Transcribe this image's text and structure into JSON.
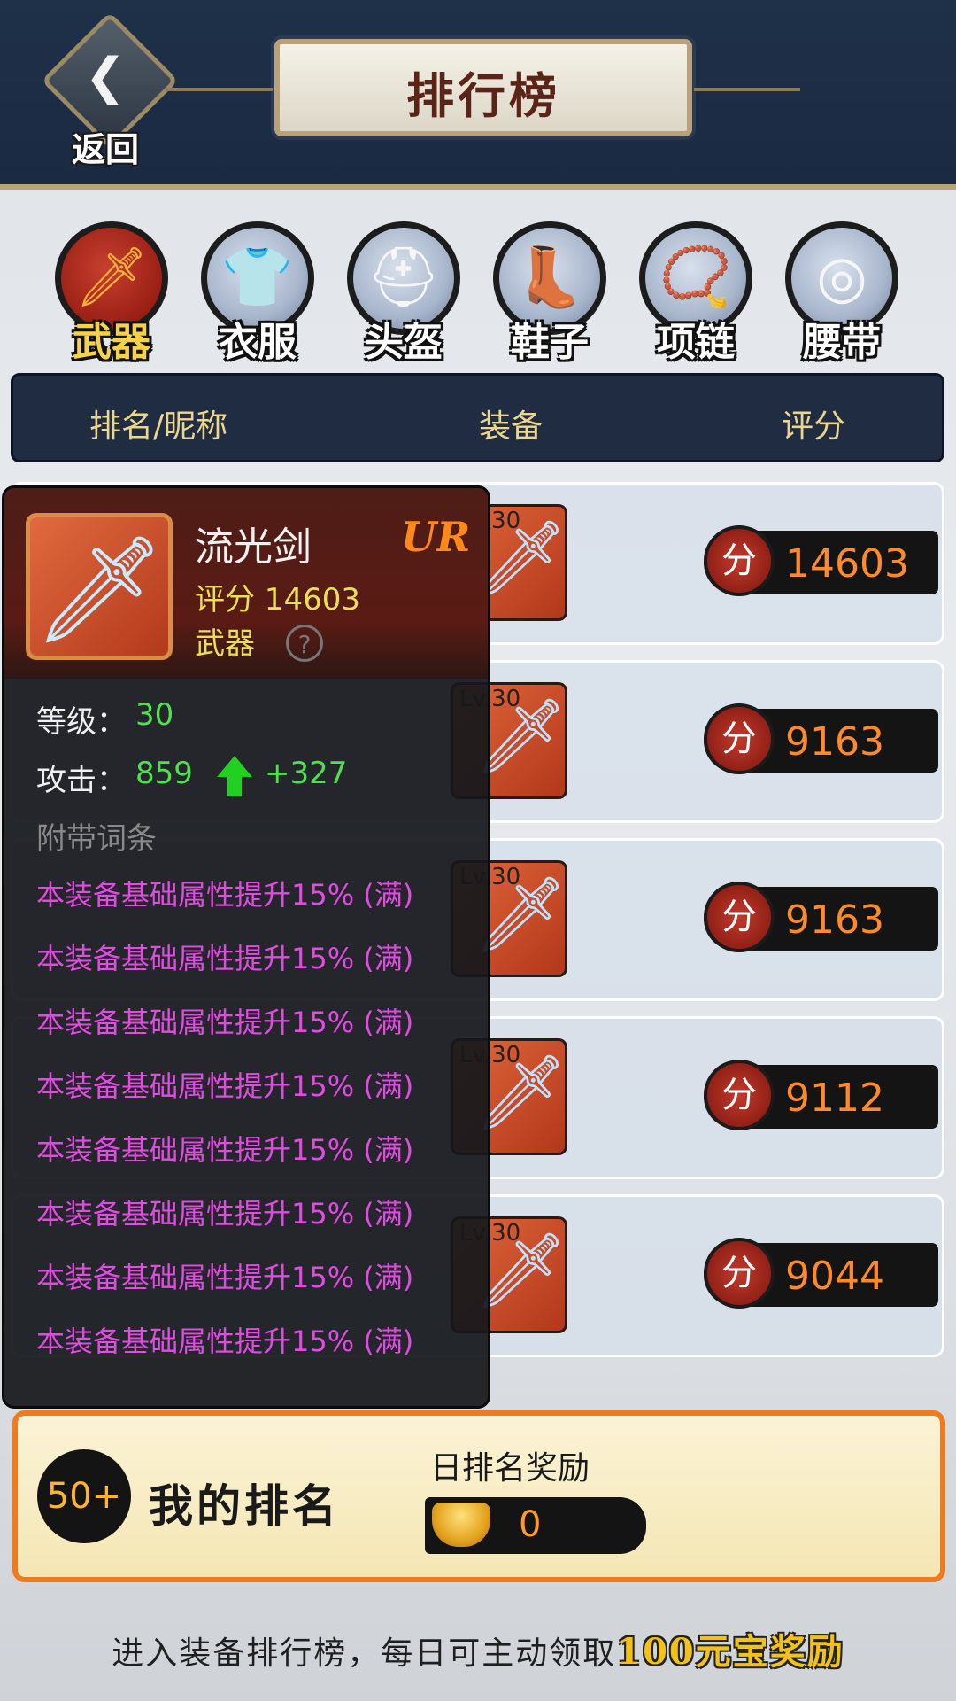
{
  "header": {
    "back_label": "返回",
    "back_glyph": "❮",
    "title": "排行榜"
  },
  "tabs": [
    {
      "label": "武器",
      "glyph": "🗡",
      "active": true
    },
    {
      "label": "衣服",
      "glyph": "👕",
      "active": false
    },
    {
      "label": "头盔",
      "glyph": "⛑",
      "active": false
    },
    {
      "label": "鞋子",
      "glyph": "👢",
      "active": false
    },
    {
      "label": "项链",
      "glyph": "📿",
      "active": false
    },
    {
      "label": "腰带",
      "glyph": "◎",
      "active": false
    }
  ],
  "table": {
    "headers": [
      "排名/昵称",
      "装备",
      "评分"
    ],
    "rows": [
      {
        "level": "Lv.30",
        "score_icon": "分",
        "score": "14603"
      },
      {
        "level": "Lv.30",
        "score_icon": "分",
        "score": "9163"
      },
      {
        "level": "Lv.30",
        "score_icon": "分",
        "score": "9163"
      },
      {
        "level": "Lv.30",
        "score_icon": "分",
        "score": "9112"
      },
      {
        "level": "Lv.30",
        "score_icon": "分",
        "score": "9044"
      }
    ]
  },
  "tooltip": {
    "name": "流光剑",
    "rarity": "UR",
    "score_text": "评分 14603",
    "type": "武器",
    "help": "?",
    "level_label": "等级：",
    "level_value": "30",
    "attack_label": "攻击：",
    "attack_value": "859",
    "attack_bonus": "+327",
    "affix_title": "附带词条",
    "affixes": [
      "本装备基础属性提升15% (满)",
      "本装备基础属性提升15% (满)",
      "本装备基础属性提升15% (满)",
      "本装备基础属性提升15% (满)",
      "本装备基础属性提升15% (满)",
      "本装备基础属性提升15% (满)",
      "本装备基础属性提升15% (满)",
      "本装备基础属性提升15% (满)"
    ]
  },
  "my_rank": {
    "badge": "50+",
    "label": "我的排名",
    "reward_title": "日排名奖励",
    "reward_value": "0"
  },
  "footer": {
    "text": "进入装备排行榜，每日可主动领取",
    "highlight": "100元宝奖励"
  },
  "colors": {
    "accent_orange": "#f07a1e",
    "score_orange": "#ff8a2a",
    "affix_purple": "#e04be0",
    "stat_green": "#4fe04f"
  }
}
